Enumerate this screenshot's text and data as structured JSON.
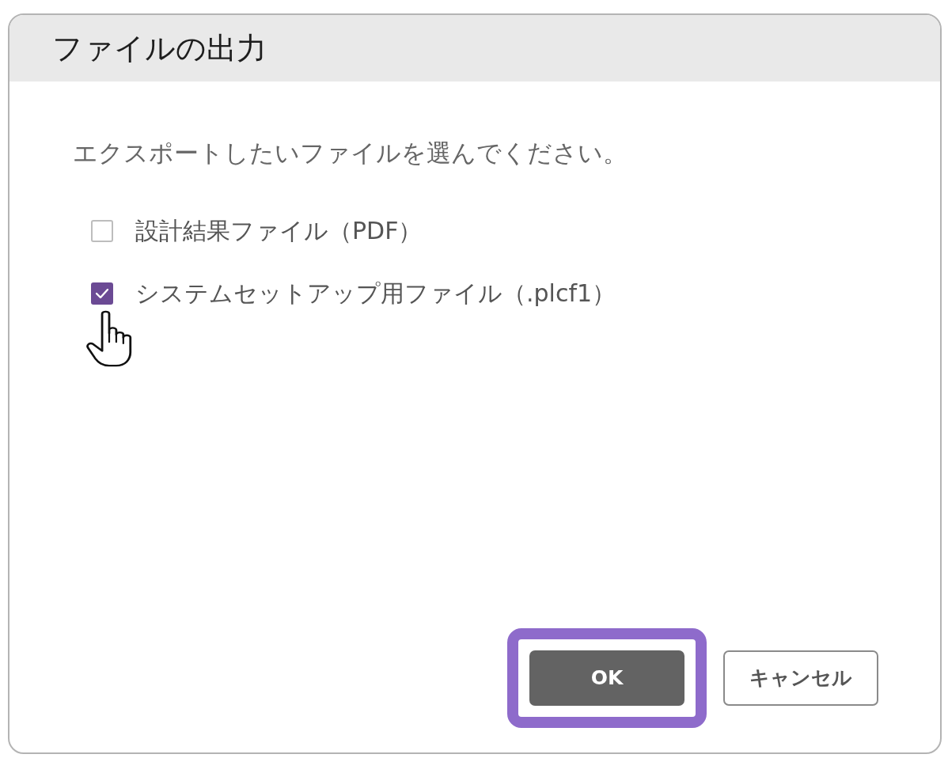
{
  "dialog": {
    "title": "ファイルの出力",
    "instruction": "エクスポートしたいファイルを選んでください。"
  },
  "options": [
    {
      "label": "設計結果ファイル（PDF）",
      "checked": false
    },
    {
      "label": "システムセットアップ用ファイル（.plcf1）",
      "checked": true
    }
  ],
  "buttons": [
    {
      "label": "OK",
      "kind": "primary",
      "highlighted": true
    },
    {
      "label": "キャンセル",
      "kind": "secondary",
      "highlighted": false
    }
  ]
}
